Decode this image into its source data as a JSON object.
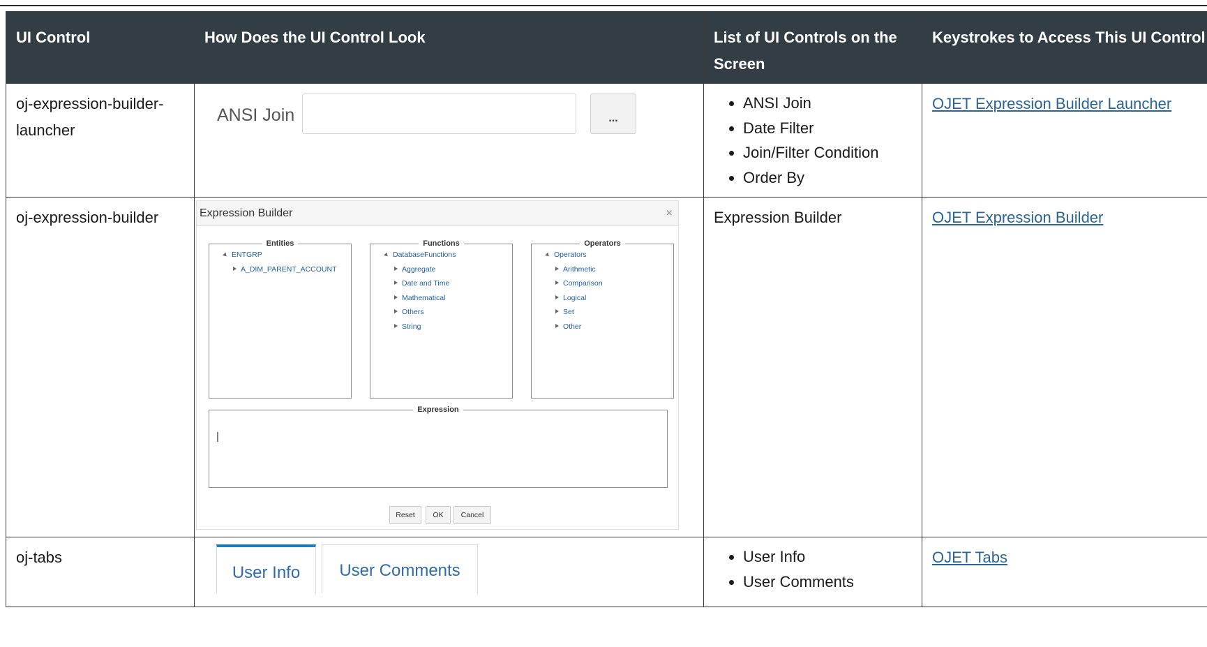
{
  "table": {
    "headers": [
      "UI Control",
      "How Does the UI Control Look",
      "List of UI Controls on the Screen",
      "Keystrokes to Access This UI Control"
    ],
    "rows": [
      {
        "control": "oj-expression-builder-launcher",
        "list_items": [
          "ANSI Join",
          "Date Filter",
          "Join/Filter Condition",
          "Order By"
        ],
        "link": "OJET Expression Builder Launcher"
      },
      {
        "control": "oj-expression-builder",
        "list_text": "Expression Builder",
        "link": "OJET Expression Builder"
      },
      {
        "control": "oj-tabs",
        "list_items": [
          "User Info",
          "User Comments"
        ],
        "link": "OJET Tabs"
      }
    ]
  },
  "launcher_preview": {
    "label": "ANSI Join",
    "button_label": "..."
  },
  "expression_builder_preview": {
    "title": "Expression Builder",
    "close_glyph": "×",
    "entities": {
      "legend": "Entities",
      "root": "ENTGRP",
      "children": [
        "A_DIM_PARENT_ACCOUNT"
      ]
    },
    "functions": {
      "legend": "Functions",
      "root": "DatabaseFunctions",
      "children": [
        "Aggregate",
        "Date and Time",
        "Mathematical",
        "Others",
        "String"
      ]
    },
    "operators": {
      "legend": "Operators",
      "root": "Operators",
      "children": [
        "Arithmetic",
        "Comparison",
        "Logical",
        "Set",
        "Other"
      ]
    },
    "expression_legend": "Expression",
    "buttons": [
      "Reset",
      "OK",
      "Cancel"
    ]
  },
  "tabs_preview": {
    "tabs": [
      "User Info",
      "User Comments"
    ],
    "active_index": 0
  },
  "colors": {
    "header_bg": "#333d44",
    "link": "#2a6496",
    "tab_accent": "#1a7dc2"
  }
}
